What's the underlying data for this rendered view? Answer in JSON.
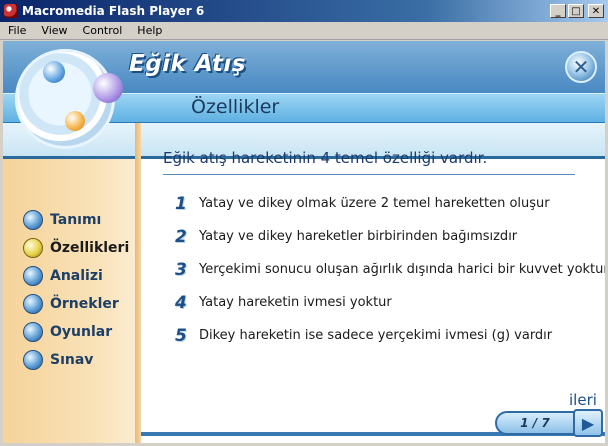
{
  "window": {
    "title": "Macromedia Flash Player 6",
    "minimize": "_",
    "maximize": "□",
    "close": "✕"
  },
  "menu": [
    "File",
    "View",
    "Control",
    "Help"
  ],
  "header": {
    "title": "Eğik Atış",
    "section": "Özellikler",
    "close_symbol": "✕"
  },
  "sidebar": {
    "items": [
      {
        "label": "Tanımı",
        "active": false
      },
      {
        "label": "Özellikleri",
        "active": true
      },
      {
        "label": "Analizi",
        "active": false
      },
      {
        "label": "Örnekler",
        "active": false
      },
      {
        "label": "Oyunlar",
        "active": false
      },
      {
        "label": "Sınav",
        "active": false
      }
    ]
  },
  "content": {
    "heading": "Eğik atış hareketinin 4 temel özelliği vardır.",
    "points": [
      {
        "num": "1",
        "text": "Yatay ve dikey olmak üzere 2 temel hareketten oluşur"
      },
      {
        "num": "2",
        "text": "Yatay ve dikey hareketler birbirinden bağımsızdır"
      },
      {
        "num": "3",
        "text": "Yerçekimi sonucu oluşan ağırlık dışında harici bir kuvvet yoktur"
      },
      {
        "num": "4",
        "text": "Yatay hareketin ivmesi yoktur"
      },
      {
        "num": "5",
        "text": "Dikey hareketin ise sadece yerçekimi ivmesi (g) vardır"
      }
    ]
  },
  "footer": {
    "next_label": "ileri",
    "page": "1 / 7",
    "next_symbol": "▶"
  },
  "colors": {
    "title_bar": "#0a246a",
    "accent_blue": "#2e6fb0",
    "sidebar_bg": "#f9e2b8",
    "heading_text": "#1b3a6c"
  }
}
